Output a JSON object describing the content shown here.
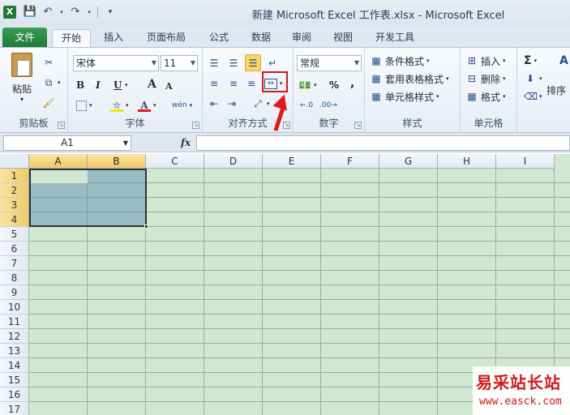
{
  "window": {
    "title": "新建 Microsoft Excel 工作表.xlsx  -  Microsoft Excel"
  },
  "quick_access": {
    "icons": [
      "save-icon",
      "undo-icon",
      "redo-icon",
      "customize-icon"
    ]
  },
  "tabs": [
    {
      "label": "文件"
    },
    {
      "label": "开始"
    },
    {
      "label": "插入"
    },
    {
      "label": "页面布局"
    },
    {
      "label": "公式"
    },
    {
      "label": "数据"
    },
    {
      "label": "审阅"
    },
    {
      "label": "视图"
    },
    {
      "label": "开发工具"
    }
  ],
  "ribbon": {
    "clipboard": {
      "label": "剪贴板",
      "paste": "粘贴"
    },
    "font": {
      "label": "字体",
      "name": "宋体",
      "size": "11",
      "bold": "B",
      "italic": "I",
      "underline": "U",
      "grow": "A",
      "shrink": "A",
      "phonetic": "wén"
    },
    "alignment": {
      "label": "对齐方式"
    },
    "number": {
      "label": "数字",
      "format": "常规",
      "percent": "%",
      "comma": ","
    },
    "styles": {
      "label": "样式",
      "conditional": "条件格式",
      "table": "套用表格格式",
      "cell_styles": "单元格样式"
    },
    "cells": {
      "label": "单元格",
      "insert": "插入",
      "delete": "删除",
      "format": "格式"
    },
    "editing": {
      "sum": "Σ",
      "sort": "排序",
      "sort_icon_letter": "A"
    }
  },
  "formula_bar": {
    "name_box": "A1",
    "fx": "fx",
    "value": ""
  },
  "grid": {
    "columns": [
      "A",
      "B",
      "C",
      "D",
      "E",
      "F",
      "G",
      "H",
      "I"
    ],
    "rows": [
      "1",
      "2",
      "3",
      "4",
      "5",
      "6",
      "7",
      "8",
      "9",
      "10",
      "11",
      "12",
      "13",
      "14",
      "15",
      "16",
      "17"
    ],
    "selected_range": "A1:B4"
  },
  "watermark": {
    "title": "易采站长站",
    "url": "www.easck.com"
  },
  "colors": {
    "file_tab": "#1f7b3a",
    "grid_bg": "#cfe8cf",
    "selection": "#6e96b9",
    "highlight": "#d11a1a",
    "header_selected": "#f2c967"
  }
}
